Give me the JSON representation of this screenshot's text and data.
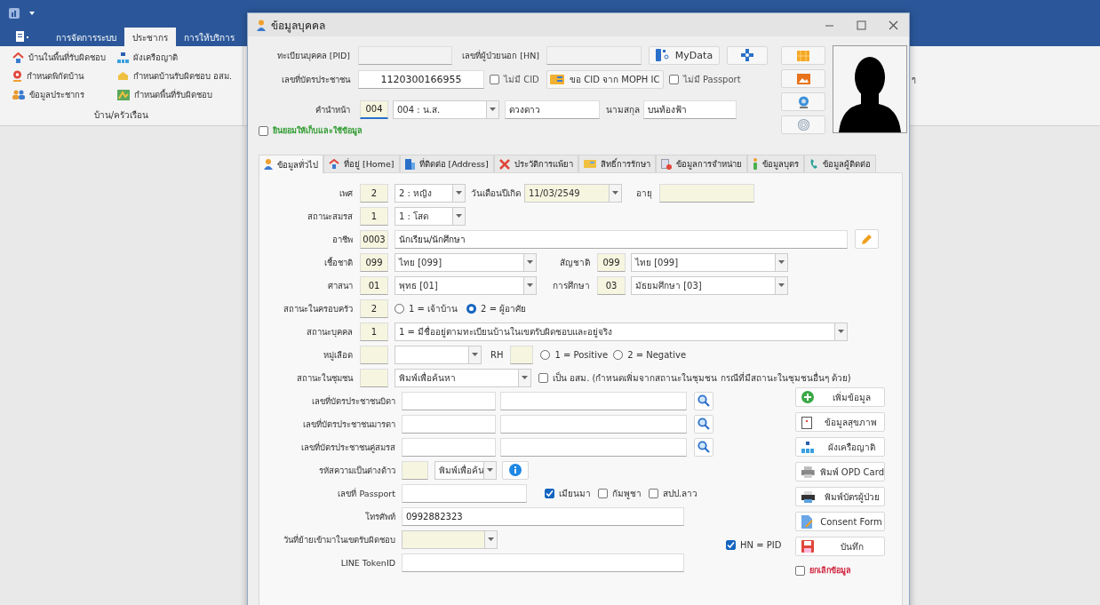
{
  "app": {
    "ribbon_tabs": [
      {
        "label": "การจัดการระบบ",
        "selected": false
      },
      {
        "label": "ประชากร",
        "selected": true
      },
      {
        "label": "การให้บริการ",
        "selected": false
      }
    ],
    "ribbon_items": [
      "บ้านในพื้นที่รับผิดชอบ",
      "ผังเครือญาติ",
      "กำหนดพิกัดบ้าน",
      "กำหนดบ้านรับผิดชอบ อสม.",
      "ข้อมูลประชากร",
      "กำหนดพื้นที่รับผิดชอบ"
    ],
    "ribbon_group": "บ้าน/ครัวเรือน",
    "ribbon_fragment": "ๆ"
  },
  "dialog": {
    "title": "ข้อมูลบุคคล",
    "pid": {
      "label": "ทะเบียนบุคคล [PID]"
    },
    "hn": {
      "label": "เลขที่ผู้ป่วยนอก [HN]"
    },
    "mydata_button": "MyData",
    "cid": {
      "label": "เลขที่บัตรประชาชน",
      "value": "1120300166955"
    },
    "no_cid": {
      "label": "ไม่มี CID",
      "checked": false
    },
    "moph_button": "ขอ CID จาก MOPH IC",
    "no_passport": {
      "label": "ไม่มี Passport",
      "checked": false
    },
    "prefix": {
      "label": "คำนำหน้า",
      "code": "004",
      "value": "004 : น.ส."
    },
    "first_name": "ดวงดาว",
    "last_name": {
      "label": "นามสกุล",
      "value": "บนท้องฟ้า"
    },
    "consent": {
      "label": "ยินยอมให้เก็บและใช้ข้อมูล",
      "checked": false
    },
    "tabs": [
      {
        "label": "ข้อมูลทั่วไป",
        "selected": true
      },
      {
        "label": "ที่อยู่ [Home]",
        "selected": false
      },
      {
        "label": "ที่ติดต่อ [Address]",
        "selected": false
      },
      {
        "label": "ประวัติการแพ้ยา",
        "selected": false
      },
      {
        "label": "สิทธิ์การรักษา",
        "selected": false
      },
      {
        "label": "ข้อมูลการจำหน่าย",
        "selected": false
      },
      {
        "label": "ข้อมูลบุตร",
        "selected": false
      },
      {
        "label": "ข้อมูลผู้ติดต่อ",
        "selected": false
      }
    ],
    "sex": {
      "label": "เพศ",
      "code": "2",
      "value": "2 : หญิง"
    },
    "birth_date": {
      "label": "วันเดือนปีเกิด",
      "value": "11/03/2549"
    },
    "age": {
      "label": "อายุ"
    },
    "marital": {
      "label": "สถานะสมรส",
      "code": "1",
      "value": "1 : โสด"
    },
    "occupation": {
      "label": "อาชีพ",
      "code": "0003",
      "value": "นักเรียน/นักศึกษา"
    },
    "race": {
      "label": "เชื้อชาติ",
      "code": "099",
      "value": "ไทย [099]"
    },
    "nationality": {
      "label": "สัญชาติ",
      "code": "099",
      "value": "ไทย [099]"
    },
    "religion": {
      "label": "ศาสนา",
      "code": "01",
      "value": "พุทธ [01]"
    },
    "education": {
      "label": "การศึกษา",
      "code": "03",
      "value": "มัธยมศึกษา [03]"
    },
    "family_status": {
      "label": "สถานะในครอบครัว",
      "code": "2",
      "options": [
        {
          "label": "1 = เจ้าบ้าน",
          "selected": false
        },
        {
          "label": "2 = ผู้อาศัย",
          "selected": true
        }
      ]
    },
    "person_status": {
      "label": "สถานะบุคคล",
      "code": "1",
      "value": "1 = มีชื่ออยู่ตามทะเบียนบ้านในเขตรับผิดชอบและอยู่จริง"
    },
    "blood_group": {
      "label": "หมู่เลือด"
    },
    "rh": {
      "label": "RH",
      "options": [
        {
          "label": "1 = Positive",
          "selected": false
        },
        {
          "label": "2 = Negative",
          "selected": false
        }
      ]
    },
    "community_status": {
      "label": "สถานะในชุมชน",
      "placeholder": "พิมพ์เพื่อค้นหา"
    },
    "vhv": {
      "label": "เป็น อสม. (กำหนดเพิ่มจากสถานะในชุมชน กรณีที่มีสถานะในชุมชนอื่นๆ ด้วย)",
      "checked": false
    },
    "id_lookups": [
      "เลขที่บัตรประชาชนบิดา",
      "เลขที่บัตรประชาชนมารดา",
      "เลขที่บัตรประชาชนคู่สมรส"
    ],
    "alien_code": {
      "label": "รหัสความเป็นต่างด้าว",
      "placeholder": "พิมพ์เพื่อค้น"
    },
    "passport": {
      "label": "เลขที่ Passport",
      "countries": [
        {
          "label": "เมียนมา",
          "checked": true
        },
        {
          "label": "กัมพูชา",
          "checked": false
        },
        {
          "label": "สปป.ลาว",
          "checked": false
        }
      ]
    },
    "phone": {
      "label": "โทรศัพท์",
      "value": "0992882323"
    },
    "move_in_date": {
      "label": "วันที่ย้ายเข้ามาในเขตรับผิดชอบ"
    },
    "line_token": {
      "label": "LINE TokenID"
    },
    "hn_eq_pid": {
      "label": "HN = PID",
      "checked": true
    },
    "actions": [
      "เพิ่มข้อมูล",
      "ข้อมูลสุขภาพ",
      "ผังเครือญาติ",
      "พิมพ์ OPD Card",
      "พิมพ์บัตรผู้ป่วย",
      "Consent Form",
      "บันทึก"
    ],
    "cancel": {
      "label": "ยกเลิกข้อมูล",
      "checked": false
    }
  }
}
